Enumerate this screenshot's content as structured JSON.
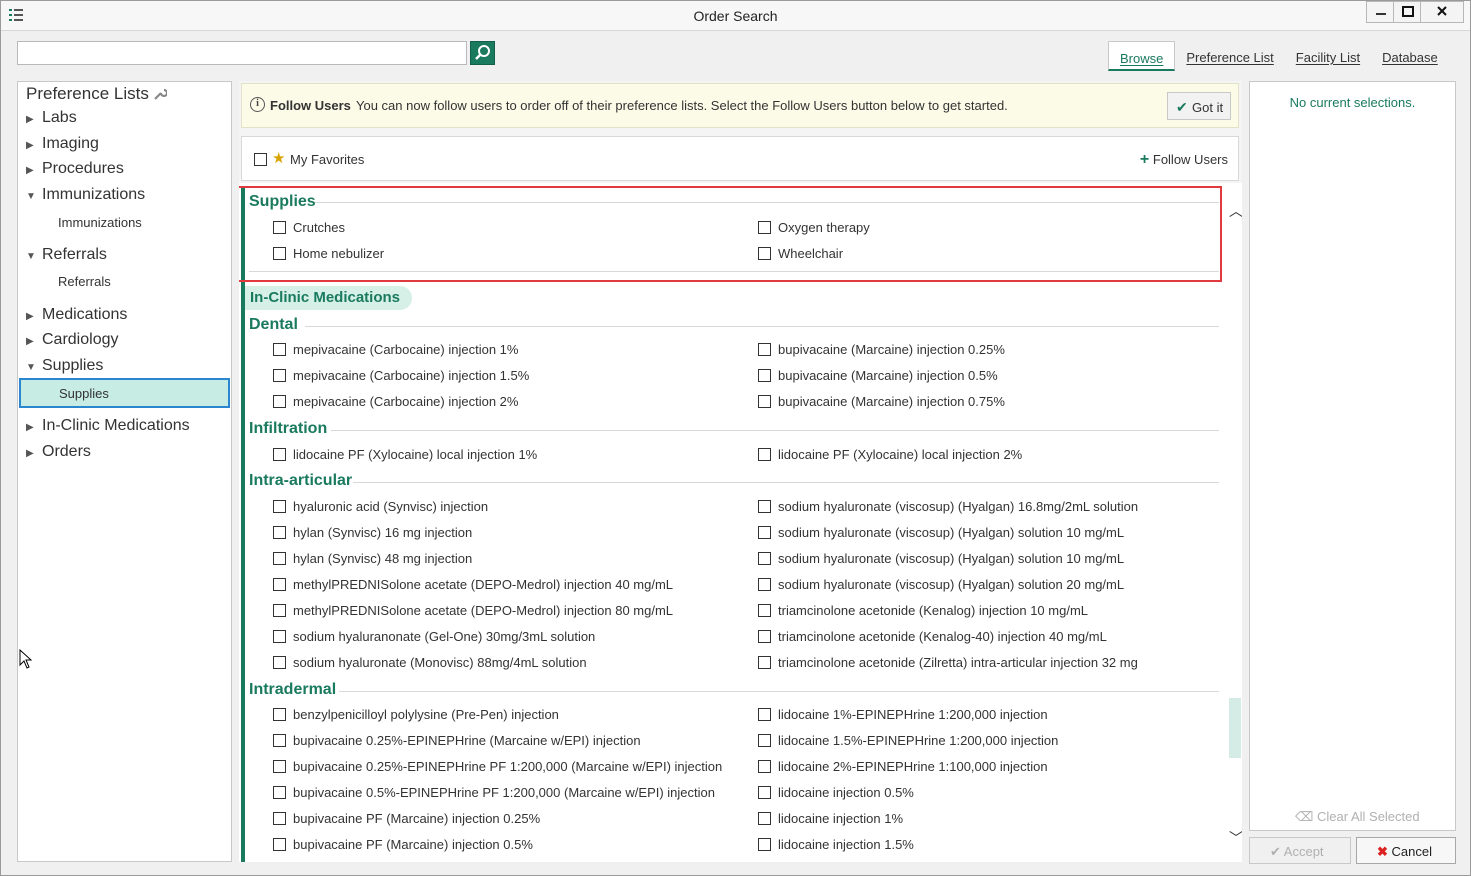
{
  "window": {
    "title": "Order Search"
  },
  "search": {
    "value": "",
    "placeholder": ""
  },
  "tabs": [
    {
      "label": "Browse"
    },
    {
      "label": "Preference List"
    },
    {
      "label": "Facility List"
    },
    {
      "label": "Database"
    }
  ],
  "left": {
    "heading": "Preference Lists",
    "tree": [
      {
        "label": "Labs"
      },
      {
        "label": "Imaging"
      },
      {
        "label": "Procedures"
      },
      {
        "label": "Immunizations",
        "child": "Immunizations"
      },
      {
        "label": "Referrals",
        "child": "Referrals"
      },
      {
        "label": "Medications"
      },
      {
        "label": "Cardiology"
      },
      {
        "label": "Supplies",
        "child": "Supplies"
      },
      {
        "label": "In-Clinic Medications"
      },
      {
        "label": "Orders"
      }
    ]
  },
  "banner": {
    "title": "Follow Users",
    "text": "You can now follow users to order off of their preference lists. Select the Follow Users button below to get started.",
    "button": "Got it"
  },
  "favorites": {
    "label": "My Favorites",
    "follow_label": "Follow Users"
  },
  "supplies": {
    "title": "Supplies",
    "items": [
      "Crutches",
      "Oxygen therapy",
      "Home nebulizer",
      "Wheelchair"
    ]
  },
  "inclinic_title": "In-Clinic Medications",
  "dental": {
    "title": "Dental",
    "items": [
      "mepivacaine (Carbocaine) injection 1%",
      "bupivacaine (Marcaine) injection 0.25%",
      "mepivacaine (Carbocaine) injection 1.5%",
      "bupivacaine (Marcaine) injection 0.5%",
      "mepivacaine (Carbocaine) injection 2%",
      "bupivacaine (Marcaine) injection 0.75%"
    ]
  },
  "infiltration": {
    "title": "Infiltration",
    "items": [
      "lidocaine PF (Xylocaine) local injection 1%",
      "lidocaine PF (Xylocaine) local injection 2%"
    ]
  },
  "intra": {
    "title": "Intra-articular",
    "items": [
      "hyaluronic acid (Synvisc) injection",
      "sodium hyaluronate (viscosup) (Hyalgan) 16.8mg/2mL solution",
      "hylan (Synvisc) 16 mg injection",
      "sodium hyaluronate (viscosup) (Hyalgan) solution 10 mg/mL",
      "hylan (Synvisc) 48 mg injection",
      "sodium hyaluronate (viscosup) (Hyalgan) solution 10 mg/mL",
      "methylPREDNISolone acetate (DEPO-Medrol) injection 40 mg/mL",
      "sodium hyaluronate (viscosup) (Hyalgan) solution 20 mg/mL",
      "methylPREDNISolone acetate (DEPO-Medrol) injection 80 mg/mL",
      "triamcinolone acetonide (Kenalog) injection 10 mg/mL",
      "sodium hyaluranonate (Gel-One) 30mg/3mL solution",
      "triamcinolone acetonide (Kenalog-40) injection 40 mg/mL",
      "sodium hyaluronate (Monovisc) 88mg/4mL solution",
      "triamcinolone acetonide (Zilretta) intra-articular injection 32 mg"
    ]
  },
  "intradermal": {
    "title": "Intradermal",
    "items": [
      "benzylpenicilloyl polylysine (Pre-Pen) injection",
      "lidocaine 1%-EPINEPHrine 1:200,000 injection",
      "bupivacaine 0.25%-EPINEPHrine (Marcaine w/EPI) injection",
      "lidocaine 1.5%-EPINEPHrine 1:200,000 injection",
      "bupivacaine 0.25%-EPINEPHrine PF 1:200,000 (Marcaine w/EPI) injection",
      "lidocaine 2%-EPINEPHrine 1:100,000 injection",
      "bupivacaine 0.5%-EPINEPHrine PF 1:200,000 (Marcaine w/EPI) injection",
      "lidocaine injection 0.5%",
      "bupivacaine PF (Marcaine) injection 0.25%",
      "lidocaine injection 1%",
      "bupivacaine PF (Marcaine) injection 0.5%",
      "lidocaine injection 1.5%"
    ]
  },
  "right": {
    "empty": "No current selections.",
    "clear": "Clear All Selected"
  },
  "footer": {
    "accept": "Accept",
    "cancel": "Cancel"
  },
  "colors": {
    "accent": "#1a7a5e",
    "highlight": "#e0393e",
    "selection": "#c7ece3"
  }
}
